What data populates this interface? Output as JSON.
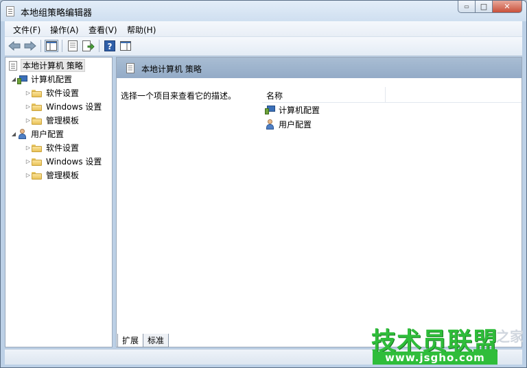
{
  "window": {
    "title": "本地组策略编辑器"
  },
  "caption_buttons": {
    "minimize": "▭",
    "maximize": "□",
    "close": "✕"
  },
  "menu": {
    "items": [
      {
        "label": "文件(F)"
      },
      {
        "label": "操作(A)"
      },
      {
        "label": "查看(V)"
      },
      {
        "label": "帮助(H)"
      }
    ]
  },
  "toolbar": {
    "buttons": [
      {
        "icon": "back-arrow-icon"
      },
      {
        "icon": "forward-arrow-icon"
      },
      {
        "icon": "show-hide-tree-icon"
      },
      {
        "icon": "properties-icon"
      },
      {
        "icon": "export-list-icon"
      },
      {
        "icon": "help-icon"
      },
      {
        "icon": "show-hide-action-pane-icon"
      }
    ]
  },
  "tree": {
    "root": "本地计算机 策略",
    "nodes": [
      {
        "label": "计算机配置",
        "children": [
          "软件设置",
          "Windows 设置",
          "管理模板"
        ]
      },
      {
        "label": "用户配置",
        "children": [
          "软件设置",
          "Windows 设置",
          "管理模板"
        ]
      }
    ]
  },
  "detail": {
    "header": "本地计算机 策略",
    "description": "选择一个项目来查看它的描述。",
    "column_name": "名称",
    "items": [
      {
        "label": "计算机配置"
      },
      {
        "label": "用户配置"
      }
    ]
  },
  "tabs": [
    {
      "label": "扩展",
      "active": true
    },
    {
      "label": "标准",
      "active": false
    }
  ],
  "watermark": {
    "main": "技术员联盟",
    "site": "www.jsgho.com",
    "side": "之家"
  },
  "colors": {
    "header": "#9bb2cc",
    "watermark": "#2fbd3a",
    "title_bar": "#cfdff0"
  }
}
